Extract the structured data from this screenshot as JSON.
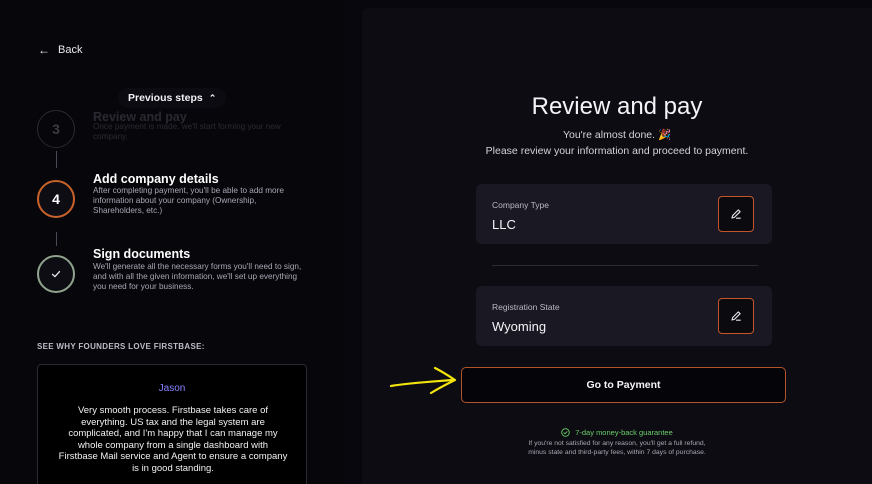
{
  "nav": {
    "back_label": "Back"
  },
  "steps": {
    "toggle_label": "Previous steps",
    "items": [
      {
        "number": "3",
        "title": "Review and pay",
        "description": "Once payment is made, we'll start forming your new company."
      },
      {
        "number": "4",
        "title": "Add company details",
        "description": "After completing payment, you'll be able to add more information about your company (Ownership, Shareholders, etc.)"
      },
      {
        "number": "",
        "title": "Sign documents",
        "description": "We'll generate all the necessary forms you'll need to sign, and with all the given information, we'll set up everything you need for your business."
      }
    ]
  },
  "testimonials": {
    "heading": "SEE WHY FOUNDERS LOVE FIRSTBASE:",
    "name": "Jason",
    "quote": "Very smooth process. Firstbase takes care of everything. US tax and the legal system are complicated, and I'm happy that I can manage my whole company from a single dashboard with Firstbase Mail service and Agent to ensure a company is in good standing."
  },
  "review": {
    "title": "Review and pay",
    "subtitle_line1": "You're almost done. 🎉",
    "subtitle_line2": "Please review your information and proceed to payment.",
    "company_type": {
      "label": "Company Type",
      "value": "LLC"
    },
    "registration_state": {
      "label": "Registration State",
      "value": "Wyoming"
    },
    "pay_button": "Go to Payment",
    "guarantee": "7-day money-back guarantee",
    "refund_line1": "If you're not satisfied for any reason, you'll get a full refund,",
    "refund_line2": "minus state and third-party fees, within 7 days of purchase."
  },
  "colors": {
    "accent_orange": "#c4562a",
    "guarantee_green": "#6ad06a",
    "testimonial_name": "#8a84ff",
    "annotation_yellow": "#f2e40c"
  },
  "icons": {
    "back": "arrow-left-icon",
    "toggle": "chevron-up-icon",
    "completed": "check-icon",
    "edit": "pencil-icon",
    "guarantee": "shield-check-icon"
  }
}
